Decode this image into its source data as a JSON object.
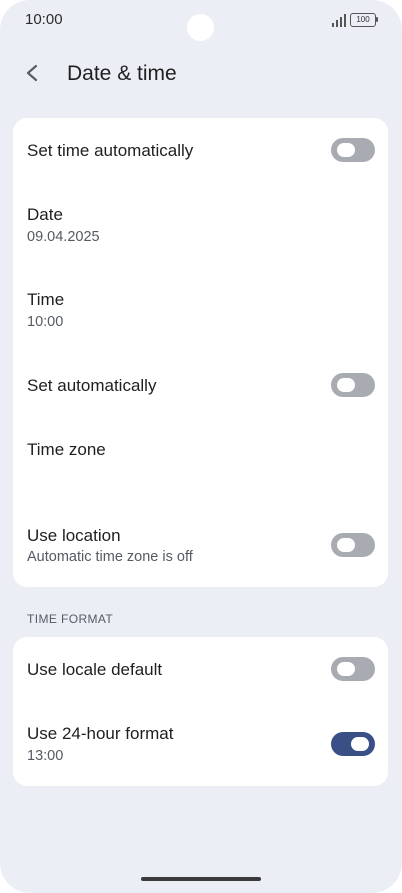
{
  "status_bar": {
    "time": "10:00",
    "battery": "100"
  },
  "header": {
    "title": "Date & time"
  },
  "main_card": {
    "set_time_automatically": {
      "label": "Set time automatically",
      "enabled": false
    },
    "date": {
      "label": "Date",
      "value": "09.04.2025"
    },
    "time": {
      "label": "Time",
      "value": "10:00"
    },
    "set_automatically": {
      "label": "Set automatically",
      "enabled": false
    },
    "time_zone": {
      "label": "Time zone"
    },
    "use_location": {
      "label": "Use location",
      "subtitle": "Automatic time zone is off",
      "enabled": false
    }
  },
  "time_format": {
    "section_label": "TIME FORMAT",
    "use_locale_default": {
      "label": "Use locale default",
      "enabled": false
    },
    "use_24_hour": {
      "label": "Use 24-hour format",
      "subtitle": "13:00",
      "enabled": true
    }
  },
  "icons": {
    "back": "chevron-left-icon",
    "signal": "signal-icon",
    "battery": "battery-icon"
  },
  "colors": {
    "background": "#eceef6",
    "card": "#ffffff",
    "toggle_off": "#a9abb2",
    "toggle_on": "#3a4f86"
  }
}
